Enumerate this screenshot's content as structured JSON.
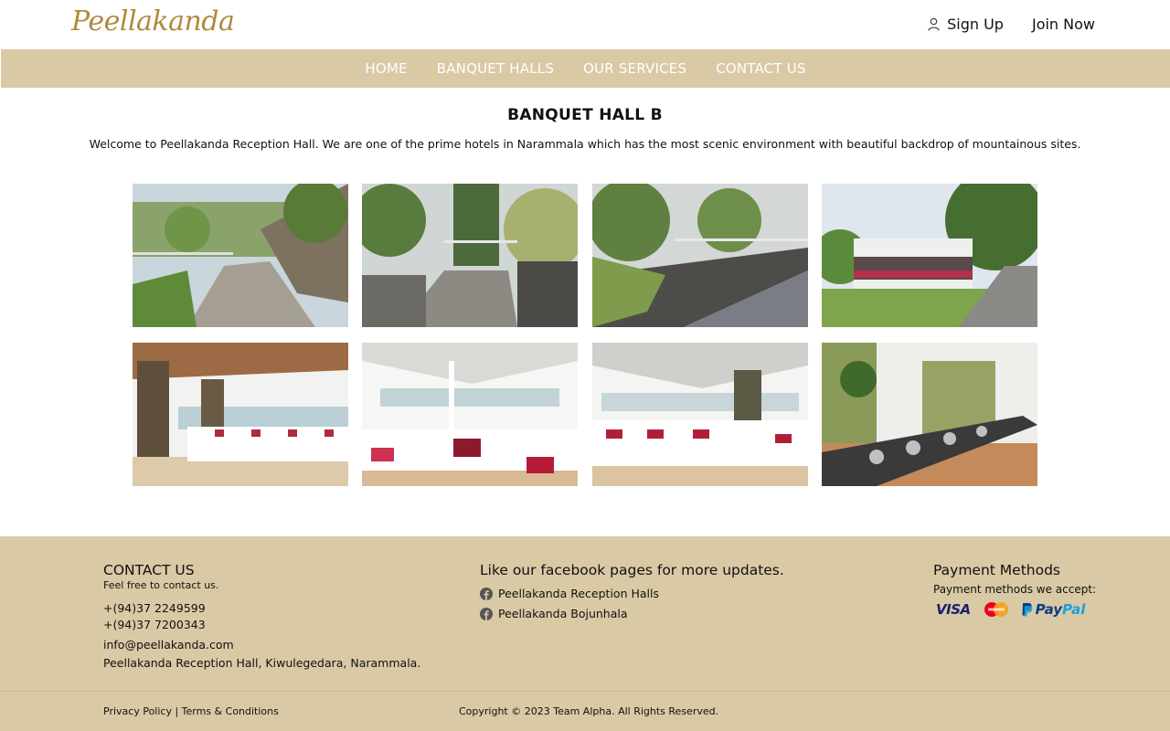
{
  "header": {
    "logo": "Peellakanda",
    "sign_up": "Sign Up",
    "join_now": "Join Now"
  },
  "nav": {
    "items": [
      {
        "label": "HOME"
      },
      {
        "label": "BANQUET HALLS"
      },
      {
        "label": "OUR SERVICES"
      },
      {
        "label": "CONTACT US"
      }
    ]
  },
  "main": {
    "title": "BANQUET HALL B",
    "intro": "Welcome to Peellakanda Reception Hall. We are one of the prime hotels in Narammala which has the most scenic environment with beautiful backdrop of mountainous sites."
  },
  "footer": {
    "contact": {
      "heading": "CONTACT US",
      "subheading": "Feel free to contact us.",
      "phone1": "+(94)37 2249599",
      "phone2": "+(94)37 7200343",
      "email": "info@peellakanda.com",
      "address": "Peellakanda Reception Hall, Kiwulegedara, Narammala."
    },
    "facebook": {
      "heading": "Like our facebook pages for more updates.",
      "pages": [
        {
          "label": "Peellakanda Reception Halls"
        },
        {
          "label": "Peellakanda Bojunhala"
        }
      ]
    },
    "payment": {
      "heading": "Payment Methods",
      "subheading": "Payment methods we accept:",
      "visa": "VISA",
      "paypal_a": "Pay",
      "paypal_b": "Pal"
    },
    "legal": {
      "privacy": "Privacy Policy",
      "separator": " | ",
      "terms": "Terms & Conditions"
    },
    "copyright": "Copyright © 2023 Team Alpha. All Rights Reserved."
  },
  "colors": {
    "accent": "#d9c9a5",
    "logo": "#b08a3c"
  }
}
